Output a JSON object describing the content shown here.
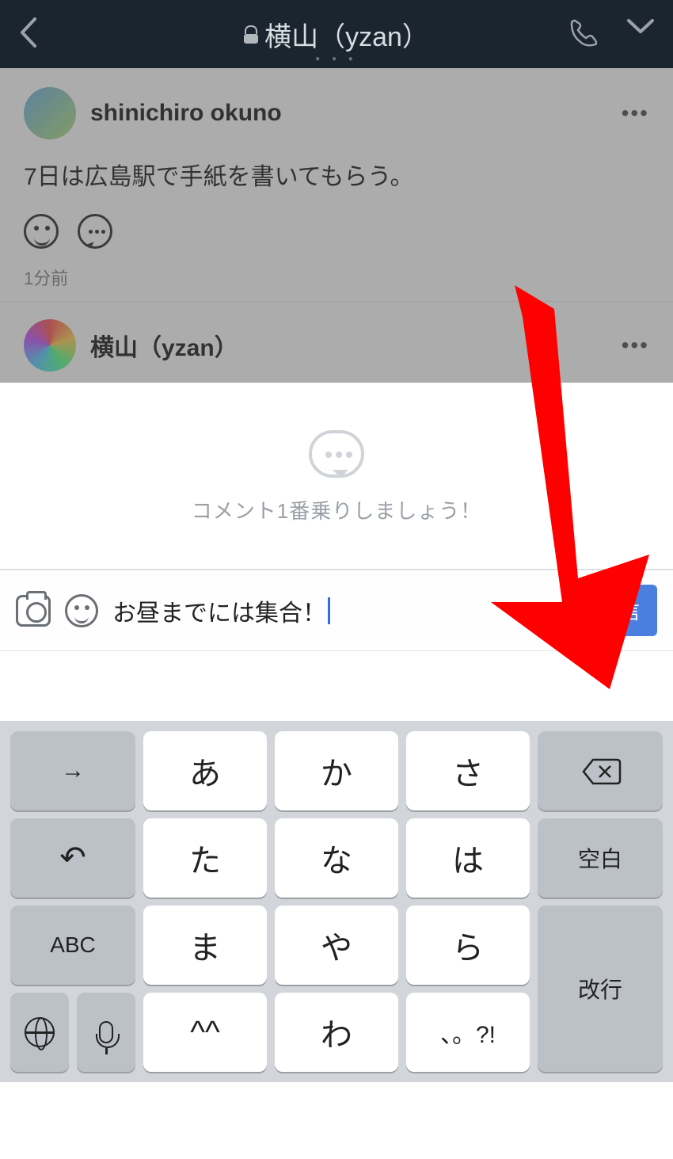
{
  "header": {
    "title": "横山（yzan）"
  },
  "posts": [
    {
      "username": "shinichiro okuno",
      "body": "7日は広島駅で手紙を書いてもらう。",
      "timestamp": "1分前"
    },
    {
      "username": "横山（yzan）"
    }
  ],
  "comment_prompt": "コメント1番乗りしましょう！",
  "input": {
    "text": "お昼までには集合！",
    "send": "送信"
  },
  "keyboard": {
    "r1": {
      "left": "→",
      "k1": "あ",
      "k2": "か",
      "k3": "さ"
    },
    "r2": {
      "k1": "た",
      "k2": "な",
      "k3": "は",
      "right": "空白"
    },
    "r3": {
      "left": "ABC",
      "k1": "ま",
      "k2": "や",
      "k3": "ら"
    },
    "r4": {
      "k1": "^^",
      "k2": "わ",
      "k3": "、。?!",
      "right": "改行"
    }
  }
}
